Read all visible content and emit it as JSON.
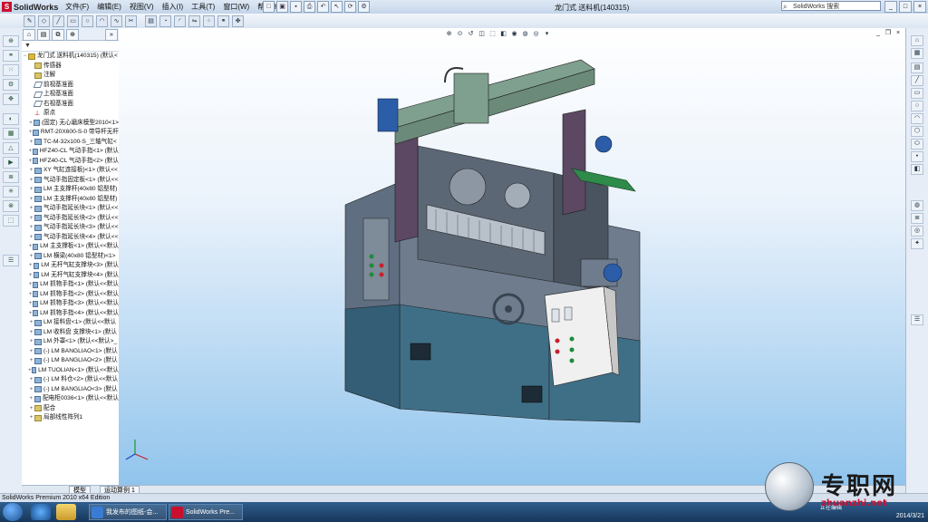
{
  "app": {
    "name": "SolidWorks",
    "logo_mark": "S"
  },
  "menu": [
    "文件(F)",
    "编辑(E)",
    "视图(V)",
    "插入(I)",
    "工具(T)",
    "窗口(W)",
    "帮助(H)"
  ],
  "document_title": "龙门式 送料机(140315)",
  "search": {
    "value": "SolidWorks 搜索",
    "icon": "search-icon"
  },
  "window_buttons": [
    "_",
    "□",
    "×"
  ],
  "feature_tree": {
    "filter_icon": "filter-icon",
    "root": "龙门式 送料机(140315) (默认<",
    "nodes": [
      {
        "label": "传感器",
        "type": "folder"
      },
      {
        "label": "注解",
        "type": "folder"
      },
      {
        "label": "前视基准面",
        "type": "plane"
      },
      {
        "label": "上视基准面",
        "type": "plane"
      },
      {
        "label": "右视基准面",
        "type": "plane"
      },
      {
        "label": "原点",
        "type": "origin"
      },
      {
        "label": "(固定) 无心磨床模型2010<1>",
        "type": "part"
      },
      {
        "label": "RMT-20X600-S-0 带导杆无杆",
        "type": "part"
      },
      {
        "label": "TC-M-32x100-S_三轴气缸<",
        "type": "part"
      },
      {
        "label": "HFZ40-CL 气动手指<1> (默认",
        "type": "part"
      },
      {
        "label": "HFZ40-CL 气动手指<2> (默认",
        "type": "part"
      },
      {
        "label": "XY 气缸连接板}<1> (默认<<",
        "type": "part"
      },
      {
        "label": "气动手指固定板<1> (默认<<",
        "type": "part"
      },
      {
        "label": "LM 主支撑杆(40x80 铝型材)",
        "type": "part"
      },
      {
        "label": "LM 主支撑杆(40x80 铝型材)",
        "type": "part"
      },
      {
        "label": "气动手指延长块<1> (默认<<",
        "type": "part"
      },
      {
        "label": "气动手指延长块<2> (默认<<",
        "type": "part"
      },
      {
        "label": "气动手指延长块<3> (默认<<",
        "type": "part"
      },
      {
        "label": "气动手指延长块<4> (默认<<",
        "type": "part"
      },
      {
        "label": "LM 主支撑板<1> (默认<<默认",
        "type": "part"
      },
      {
        "label": "LM 横梁(40x80 铝型材)<1>",
        "type": "part"
      },
      {
        "label": "LM 无杆气缸支撑块<3> (默认",
        "type": "part"
      },
      {
        "label": "LM 无杆气缸支撑块<4> (默认",
        "type": "part"
      },
      {
        "label": "LM 抓物手指<1> (默认<<默认",
        "type": "part"
      },
      {
        "label": "LM 抓物手指<2> (默认<<默认",
        "type": "part"
      },
      {
        "label": "LM 抓物手指<3> (默认<<默认",
        "type": "part"
      },
      {
        "label": "LM 抓物手指<4> (默认<<默认",
        "type": "part"
      },
      {
        "label": "LM 接料盘<1> (默认<<默认",
        "type": "part"
      },
      {
        "label": "LM 收料盘 支撑块<1> (默认",
        "type": "part"
      },
      {
        "label": "LM 外罩<1> (默认<<默认>_",
        "type": "part"
      },
      {
        "label": "(-) LM BANGLIAO<1> (默认",
        "type": "part"
      },
      {
        "label": "(-) LM BANGLIAO<2> (默认",
        "type": "part"
      },
      {
        "label": "LM TUOLIAN<1> (默认<<默认",
        "type": "part"
      },
      {
        "label": "(-) LM 料仓<2> (默认<<默认",
        "type": "part"
      },
      {
        "label": "(-) LM BANGLIAO<3> (默认",
        "type": "part"
      },
      {
        "label": "配电柜0036<1> (默认<<默认",
        "type": "part"
      },
      {
        "label": "配合",
        "type": "folder"
      },
      {
        "label": "局部线性阵列1",
        "type": "folder"
      }
    ]
  },
  "bottom_tabs": [
    "模型",
    "运动算例 1"
  ],
  "status": {
    "text": "SolidWorks Premium 2010 x64 Edition"
  },
  "taskbar": {
    "tasks": [
      {
        "label": "我发布的图纸-会...",
        "color": "#3a7bd5"
      },
      {
        "label": "SolidWorks Pre...",
        "color": "#c8102e"
      }
    ],
    "tray_text": "正在编辑",
    "date": "2014/3/21"
  },
  "watermark": {
    "title": "专职网",
    "subtitle": "zhuanzhi.net"
  },
  "colors": {
    "accent": "#c8102e",
    "viewport_top": "#ffffff",
    "viewport_bottom": "#8ec3ec"
  }
}
